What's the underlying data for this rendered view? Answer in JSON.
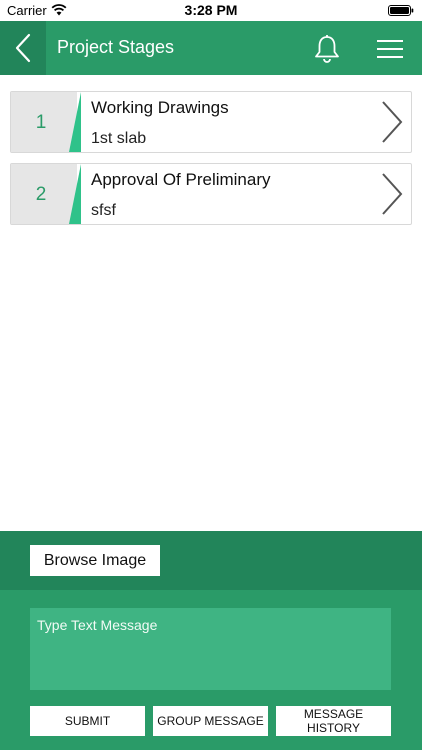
{
  "status_bar": {
    "carrier": "Carrier",
    "time": "3:28 PM",
    "wifi_icon": "wifi-icon",
    "battery_icon": "battery-icon"
  },
  "header": {
    "title": "Project Stages",
    "back_icon": "chevron-left-icon",
    "bell_icon": "bell-icon",
    "menu_icon": "hamburger-menu-icon",
    "color": "#2a9b68",
    "back_bg": "#22855a"
  },
  "stages": [
    {
      "number": "1",
      "title": "Working Drawings",
      "subtitle": "1st slab"
    },
    {
      "number": "2",
      "title": "Approval Of Preliminary",
      "subtitle": "sfsf"
    }
  ],
  "compose": {
    "browse_label": "Browse Image",
    "message_placeholder": "Type Text Message",
    "message_value": "",
    "submit_label": "SUBMIT",
    "group_message_label": "GROUP MESSAGE",
    "message_history_label": "MESSAGE HISTORY"
  },
  "colors": {
    "primary": "#2a9b68",
    "primary_dark": "#22855a",
    "input_bg": "#3fb483",
    "accent_slash": "#2fc28a"
  }
}
